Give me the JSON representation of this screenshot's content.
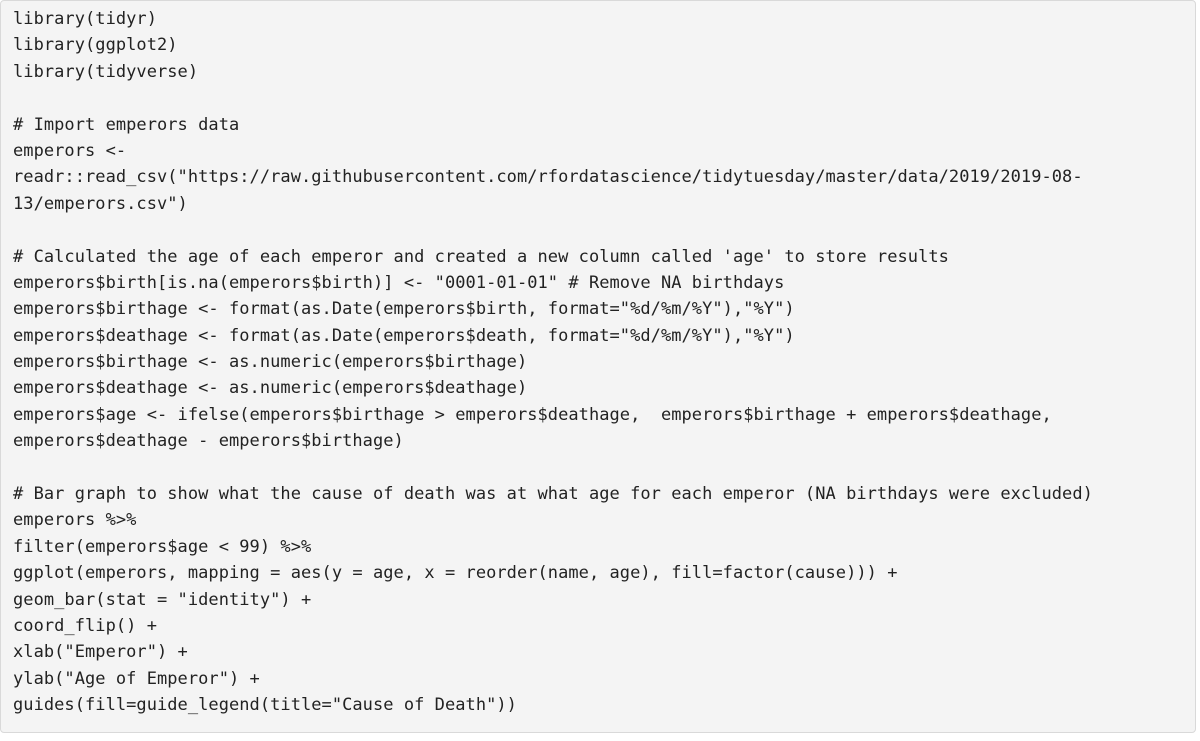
{
  "code": {
    "lines": [
      "library(tidyr)",
      "library(ggplot2)",
      "library(tidyverse)",
      "",
      "# Import emperors data",
      "emperors <-",
      "readr::read_csv(\"https://raw.githubusercontent.com/rfordatascience/tidytuesday/master/data/2019/2019-08-",
      "13/emperors.csv\")",
      "",
      "# Calculated the age of each emperor and created a new column called 'age' to store results",
      "emperors$birth[is.na(emperors$birth)] <- \"0001-01-01\" # Remove NA birthdays",
      "emperors$birthage <- format(as.Date(emperors$birth, format=\"%d/%m/%Y\"),\"%Y\")",
      "emperors$deathage <- format(as.Date(emperors$death, format=\"%d/%m/%Y\"),\"%Y\")",
      "emperors$birthage <- as.numeric(emperors$birthage)",
      "emperors$deathage <- as.numeric(emperors$deathage)",
      "emperors$age <- ifelse(emperors$birthage > emperors$deathage,  emperors$birthage + emperors$deathage,",
      "emperors$deathage - emperors$birthage)",
      "",
      "# Bar graph to show what the cause of death was at what age for each emperor (NA birthdays were excluded)",
      "emperors %>%",
      "filter(emperors$age < 99) %>%",
      "ggplot(emperors, mapping = aes(y = age, x = reorder(name, age), fill=factor(cause))) +",
      "geom_bar(stat = \"identity\") +",
      "coord_flip() +",
      "xlab(\"Emperor\") +",
      "ylab(\"Age of Emperor\") +",
      "guides(fill=guide_legend(title=\"Cause of Death\"))"
    ]
  }
}
